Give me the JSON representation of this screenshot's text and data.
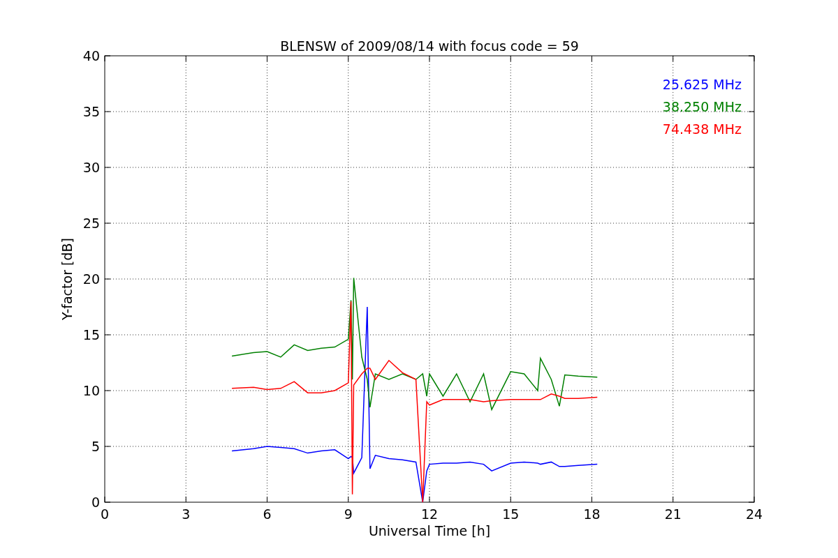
{
  "figure": {
    "chart_data": {
      "type": "line",
      "title": "BLENSW of 2009/08/14 with focus code = 59",
      "xlabel": "Universal Time [h]",
      "ylabel": "Y-factor [dB]",
      "xlim": [
        0,
        24
      ],
      "ylim": [
        0,
        40
      ],
      "xticks": [
        0,
        3,
        6,
        9,
        12,
        15,
        18,
        21,
        24
      ],
      "yticks": [
        0,
        5,
        10,
        15,
        20,
        25,
        30,
        35,
        40
      ],
      "grid": true,
      "x": [
        4.7,
        5.5,
        6,
        6.5,
        7,
        7.5,
        8,
        8.5,
        9,
        9.1,
        9.15,
        9.2,
        9.5,
        9.7,
        9.8,
        10,
        10.5,
        11,
        11.5,
        11.75,
        11.9,
        12,
        12.5,
        13,
        13.5,
        14,
        14.3,
        15,
        15.5,
        16,
        16.1,
        16.5,
        16.8,
        17,
        17.5,
        18.2
      ],
      "series": [
        {
          "name": "25.625 MHz",
          "color": "#0000ff",
          "values": [
            4.6,
            4.8,
            5.0,
            4.9,
            4.8,
            4.4,
            4.6,
            4.7,
            3.9,
            4.1,
            4.0,
            2.6,
            4.0,
            17.5,
            3.0,
            4.2,
            3.9,
            3.8,
            3.6,
            0,
            2.8,
            3.4,
            3.5,
            3.5,
            3.6,
            3.4,
            2.8,
            3.5,
            3.6,
            3.5,
            3.4,
            3.6,
            3.2,
            3.2,
            3.3,
            3.4
          ]
        },
        {
          "name": "38.250 MHz",
          "color": "#008000",
          "values": [
            13.1,
            13.4,
            13.5,
            13.0,
            14.1,
            13.6,
            13.8,
            13.9,
            14.6,
            18.1,
            11,
            20.1,
            13,
            11,
            8.5,
            11.5,
            11,
            11.5,
            11,
            11.5,
            9.5,
            11.5,
            9.5,
            11.5,
            9,
            11.5,
            8.3,
            11.7,
            11.5,
            10,
            12.9,
            11,
            8.6,
            11.4,
            11.3,
            11.2
          ]
        },
        {
          "name": "74.438 MHz",
          "color": "#ff0000",
          "values": [
            10.2,
            10.3,
            10.1,
            10.2,
            10.8,
            9.8,
            9.8,
            10,
            10.7,
            18,
            0.7,
            10.5,
            11.5,
            12,
            12,
            11,
            12.7,
            11.6,
            11,
            0,
            9,
            8.7,
            9.2,
            9.2,
            9.2,
            9.0,
            9.1,
            9.2,
            9.2,
            9.2,
            9.2,
            9.7,
            9.5,
            9.3,
            9.3,
            9.4
          ]
        }
      ]
    }
  }
}
